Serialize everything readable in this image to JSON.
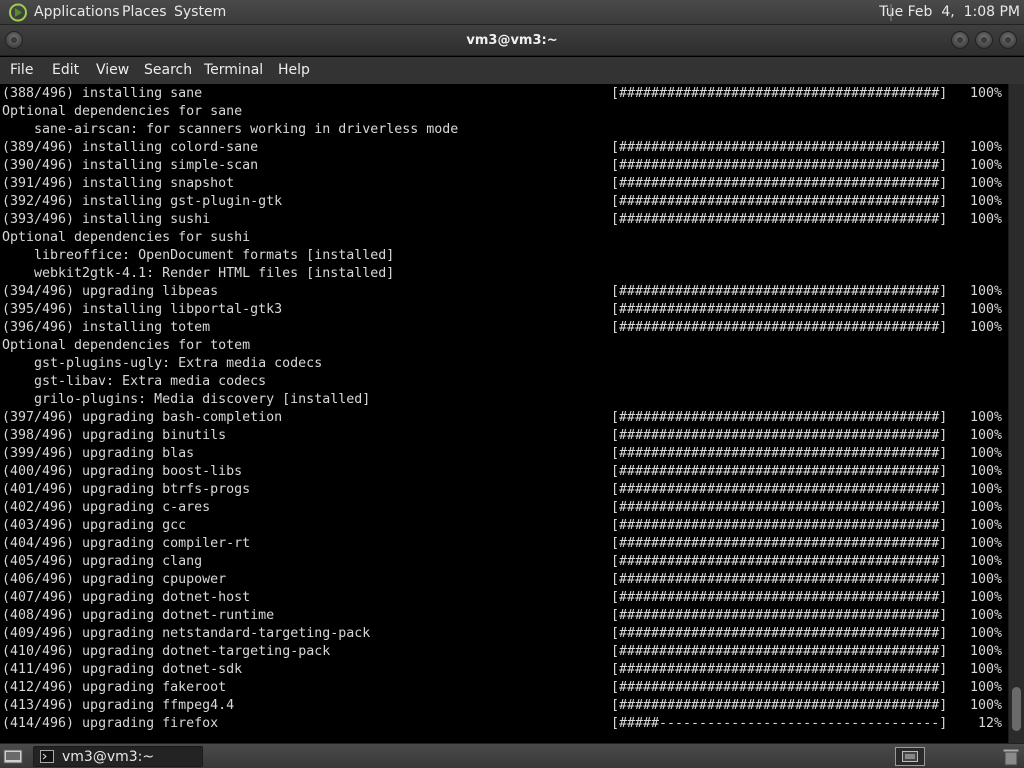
{
  "top_panel": {
    "applications": "Applications",
    "places": "Places",
    "system": "System",
    "clock": "Tue Feb  4,  1:08 PM"
  },
  "window": {
    "title": "vm3@vm3:~"
  },
  "menubar": [
    "File",
    "Edit",
    "View",
    "Search",
    "Terminal",
    "Help"
  ],
  "terminal": {
    "lines": [
      {
        "text": "(388/496) installing sane",
        "bar": "[########################################]",
        "pct": "100%"
      },
      {
        "text": "Optional dependencies for sane"
      },
      {
        "text": "sane-airscan: for scanners working in driverless mode",
        "indent": true
      },
      {
        "text": "(389/496) installing colord-sane",
        "bar": "[########################################]",
        "pct": "100%"
      },
      {
        "text": "(390/496) installing simple-scan",
        "bar": "[########################################]",
        "pct": "100%"
      },
      {
        "text": "(391/496) installing snapshot",
        "bar": "[########################################]",
        "pct": "100%"
      },
      {
        "text": "(392/496) installing gst-plugin-gtk",
        "bar": "[########################################]",
        "pct": "100%"
      },
      {
        "text": "(393/496) installing sushi",
        "bar": "[########################################]",
        "pct": "100%"
      },
      {
        "text": "Optional dependencies for sushi"
      },
      {
        "text": "libreoffice: OpenDocument formats [installed]",
        "indent": true
      },
      {
        "text": "webkit2gtk-4.1: Render HTML files [installed]",
        "indent": true
      },
      {
        "text": "(394/496) upgrading libpeas",
        "bar": "[########################################]",
        "pct": "100%"
      },
      {
        "text": "(395/496) installing libportal-gtk3",
        "bar": "[########################################]",
        "pct": "100%"
      },
      {
        "text": "(396/496) installing totem",
        "bar": "[########################################]",
        "pct": "100%"
      },
      {
        "text": "Optional dependencies for totem"
      },
      {
        "text": "gst-plugins-ugly: Extra media codecs",
        "indent": true
      },
      {
        "text": "gst-libav: Extra media codecs",
        "indent": true
      },
      {
        "text": "grilo-plugins: Media discovery [installed]",
        "indent": true
      },
      {
        "text": "(397/496) upgrading bash-completion",
        "bar": "[########################################]",
        "pct": "100%"
      },
      {
        "text": "(398/496) upgrading binutils",
        "bar": "[########################################]",
        "pct": "100%"
      },
      {
        "text": "(399/496) upgrading blas",
        "bar": "[########################################]",
        "pct": "100%"
      },
      {
        "text": "(400/496) upgrading boost-libs",
        "bar": "[########################################]",
        "pct": "100%"
      },
      {
        "text": "(401/496) upgrading btrfs-progs",
        "bar": "[########################################]",
        "pct": "100%"
      },
      {
        "text": "(402/496) upgrading c-ares",
        "bar": "[########################################]",
        "pct": "100%"
      },
      {
        "text": "(403/496) upgrading gcc",
        "bar": "[########################################]",
        "pct": "100%"
      },
      {
        "text": "(404/496) upgrading compiler-rt",
        "bar": "[########################################]",
        "pct": "100%"
      },
      {
        "text": "(405/496) upgrading clang",
        "bar": "[########################################]",
        "pct": "100%"
      },
      {
        "text": "(406/496) upgrading cpupower",
        "bar": "[########################################]",
        "pct": "100%"
      },
      {
        "text": "(407/496) upgrading dotnet-host",
        "bar": "[########################################]",
        "pct": "100%"
      },
      {
        "text": "(408/496) upgrading dotnet-runtime",
        "bar": "[########################################]",
        "pct": "100%"
      },
      {
        "text": "(409/496) upgrading netstandard-targeting-pack",
        "bar": "[########################################]",
        "pct": "100%"
      },
      {
        "text": "(410/496) upgrading dotnet-targeting-pack",
        "bar": "[########################################]",
        "pct": "100%"
      },
      {
        "text": "(411/496) upgrading dotnet-sdk",
        "bar": "[########################################]",
        "pct": "100%"
      },
      {
        "text": "(412/496) upgrading fakeroot",
        "bar": "[########################################]",
        "pct": "100%"
      },
      {
        "text": "(413/496) upgrading ffmpeg4.4",
        "bar": "[########################################]",
        "pct": "100%"
      },
      {
        "text": "(414/496) upgrading firefox",
        "bar": "[#####-----------------------------------]",
        "pct": "12%"
      }
    ]
  },
  "taskbar": {
    "task_label": "vm3@vm3:~"
  },
  "icons": {
    "applications": "gnome-foot-icon",
    "window_buttons": [
      "minimize-icon",
      "maximize-icon",
      "close-icon"
    ],
    "task": "terminal-icon",
    "workspace": "workspace-switcher-icon",
    "trash": "trash-icon"
  }
}
